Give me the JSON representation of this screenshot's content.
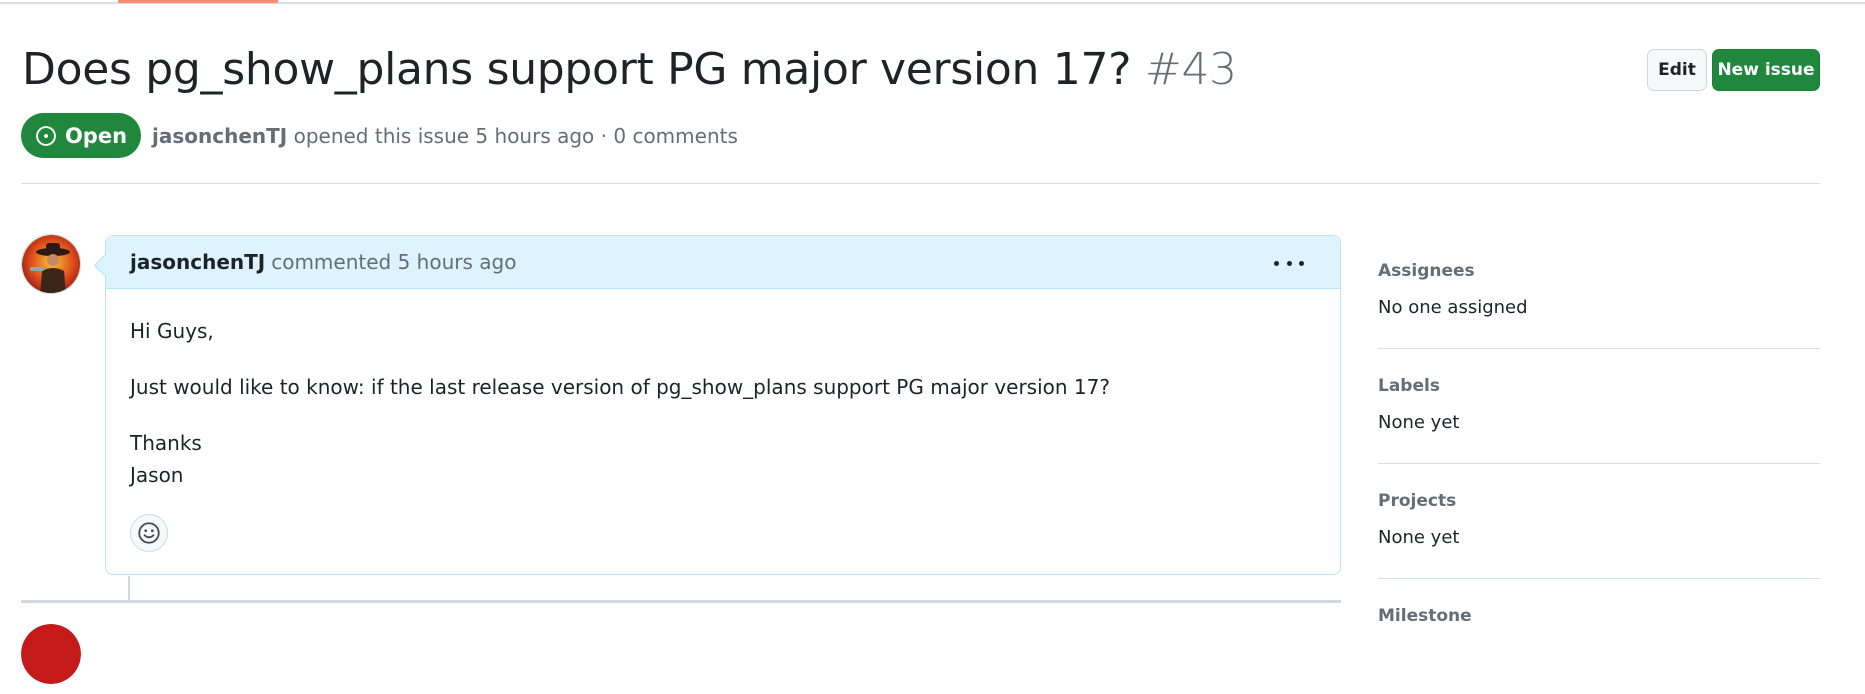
{
  "issue": {
    "title": "Does pg_show_plans support PG major version 17?",
    "number": "#43",
    "state": "Open",
    "author": "jasonchenTJ",
    "meta_text": "opened this issue 5 hours ago · 0 comments"
  },
  "actions": {
    "edit_label": "Edit",
    "new_issue_label": "New issue"
  },
  "comment": {
    "author": "jasonchenTJ",
    "action_text": "commented 5 hours ago",
    "lines": [
      "Hi Guys,",
      "Just would like to know: if the last release version of pg_show_plans support PG major version 17?",
      "Thanks",
      "Jason"
    ]
  },
  "sidebar": {
    "sections": [
      {
        "heading": "Assignees",
        "value": "No one assigned"
      },
      {
        "heading": "Labels",
        "value": "None yet"
      },
      {
        "heading": "Projects",
        "value": "None yet"
      },
      {
        "heading": "Milestone",
        "value": ""
      }
    ]
  },
  "colors": {
    "open_green": "#1f883d",
    "comment_header_bg": "#ddf4ff",
    "comment_border": "#b6e3ff",
    "tab_accent": "#fd8c73"
  },
  "icons": {
    "state": "issue-opened-icon",
    "menu": "kebab-horizontal-icon",
    "reaction": "smiley-icon"
  }
}
